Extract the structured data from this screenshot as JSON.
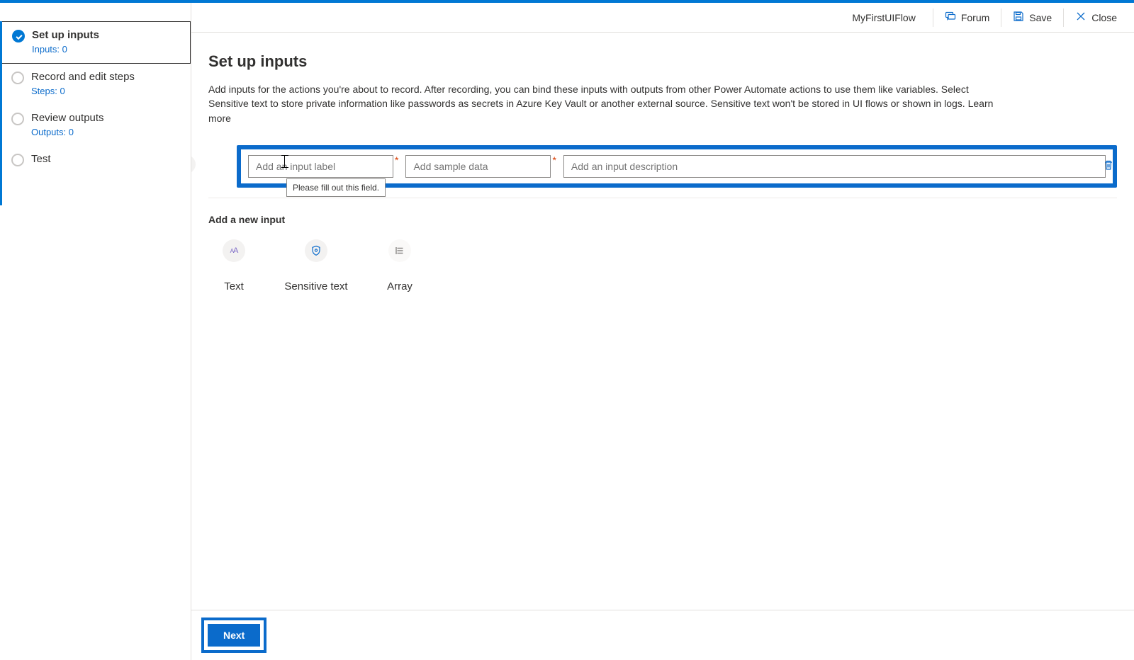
{
  "header": {
    "flow_name": "MyFirstUIFlow",
    "forum": "Forum",
    "save": "Save",
    "close": "Close"
  },
  "nav": {
    "items": [
      {
        "label": "Set up inputs",
        "sub": "Inputs: 0"
      },
      {
        "label": "Record and edit steps",
        "sub": "Steps: 0"
      },
      {
        "label": "Review outputs",
        "sub": "Outputs: 0"
      },
      {
        "label": "Test",
        "sub": ""
      }
    ]
  },
  "page": {
    "title": "Set up inputs",
    "description": "Add inputs for the actions you're about to record. After recording, you can bind these inputs with outputs from other Power Automate actions to use them like variables. Select Sensitive text to store private information like passwords as secrets in Azure Key Vault or another external source. Sensitive text won't be stored in UI flows or shown in logs. Learn more"
  },
  "input_row": {
    "label_placeholder": "Add an input label",
    "sample_placeholder": "Add sample data",
    "desc_placeholder": "Add an input description",
    "tooltip": "Please fill out this field."
  },
  "add_new": {
    "heading": "Add a new input",
    "types": [
      {
        "key": "text",
        "label": "Text"
      },
      {
        "key": "sensitive",
        "label": "Sensitive text"
      },
      {
        "key": "array",
        "label": "Array"
      }
    ]
  },
  "footer": {
    "next": "Next"
  }
}
